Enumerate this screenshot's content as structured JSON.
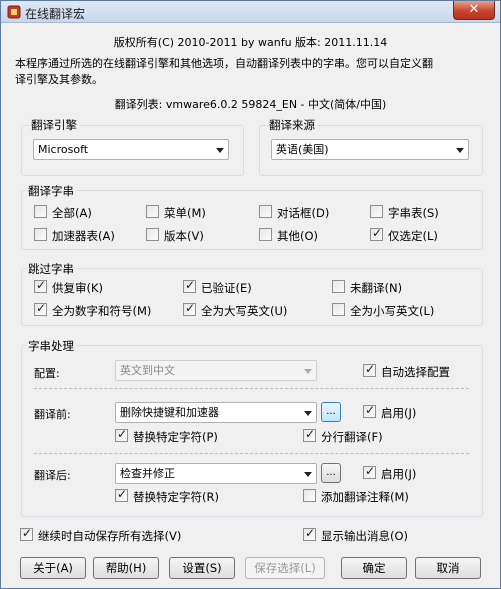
{
  "window": {
    "title": "在线翻译宏",
    "close_glyph": "✕"
  },
  "header": {
    "copyright": "版权所有(C) 2010-2011 by wanfu  版本: 2011.11.14",
    "description_line1": "本程序通过所选的在线翻译引擎和其他选项，自动翻译列表中的字串。您可以自定义翻",
    "description_line2": "译引擎及其参数。",
    "list_info": "翻译列表: vmware6.0.2 59824_EN - 中文(简体/中国)"
  },
  "engine": {
    "label": "翻译引擎",
    "value": "Microsoft"
  },
  "source": {
    "label": "翻译来源",
    "value": "英语(美国)"
  },
  "translate_strings": {
    "label": "翻译字串",
    "items": [
      {
        "label": "全部(A)",
        "checked": false
      },
      {
        "label": "菜单(M)",
        "checked": false
      },
      {
        "label": "对话框(D)",
        "checked": false
      },
      {
        "label": "字串表(S)",
        "checked": false
      },
      {
        "label": "加速器表(A)",
        "checked": false
      },
      {
        "label": "版本(V)",
        "checked": false
      },
      {
        "label": "其他(O)",
        "checked": false
      },
      {
        "label": "仅选定(L)",
        "checked": true
      }
    ]
  },
  "skip_strings": {
    "label": "跳过字串",
    "items": [
      {
        "label": "供复审(K)",
        "checked": true
      },
      {
        "label": "已验证(E)",
        "checked": true
      },
      {
        "label": "未翻译(N)",
        "checked": false
      },
      {
        "label": "全为数字和符号(M)",
        "checked": true
      },
      {
        "label": "全为大写英文(U)",
        "checked": true
      },
      {
        "label": "全为小写英文(L)",
        "checked": false
      }
    ]
  },
  "processing": {
    "label": "字串处理",
    "config_label": "配置:",
    "config_value": "英文到中文",
    "auto_select": {
      "label": "自动选择配置",
      "checked": true
    },
    "before": {
      "label": "翻译前:",
      "value": "删除快捷键和加速器",
      "more": "...",
      "enable": {
        "label": "启用(J)",
        "checked": true
      },
      "replace": {
        "label": "替换特定字符(P)",
        "checked": true
      },
      "split": {
        "label": "分行翻译(F)",
        "checked": true
      }
    },
    "after": {
      "label": "翻译后:",
      "value": "检查并修正",
      "more": "...",
      "enable": {
        "label": "启用(J)",
        "checked": true
      },
      "replace": {
        "label": "替换特定字符(R)",
        "checked": true
      },
      "add_note": {
        "label": "添加翻译注释(M)",
        "checked": false
      }
    }
  },
  "options": {
    "autosave": {
      "label": "继续时自动保存所有选择(V)",
      "checked": true
    },
    "show_output": {
      "label": "显示输出消息(O)",
      "checked": true
    }
  },
  "buttons": {
    "about": "关于(A)",
    "help": "帮助(H)",
    "settings": "设置(S)",
    "save_selection": "保存选择(L)",
    "ok": "确定",
    "cancel": "取消"
  }
}
